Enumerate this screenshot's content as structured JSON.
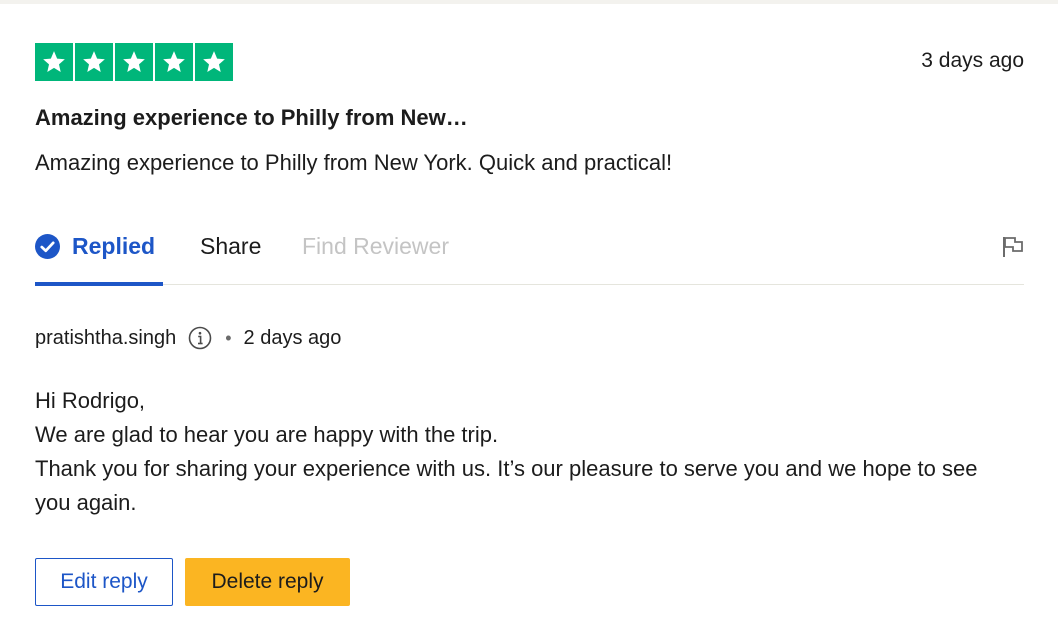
{
  "review": {
    "rating": 5,
    "rating_color": "#00b67a",
    "date": "3 days ago",
    "title": "Amazing experience to Philly from New…",
    "body": "Amazing experience to Philly from New York. Quick and practical!"
  },
  "tabs": {
    "replied": "Replied",
    "share": "Share",
    "find_reviewer": "Find Reviewer",
    "active_color": "#1d56c7",
    "disabled_color": "#c4c4c4"
  },
  "reply": {
    "author": "pratishtha.singh",
    "separator": "•",
    "date": "2 days ago",
    "lines": [
      "Hi Rodrigo,",
      "We are glad to hear you are happy with the trip.",
      "Thank you for sharing your experience with us. It’s our pleasure to serve you and we hope to see you again."
    ]
  },
  "actions": {
    "edit_label": "Edit reply",
    "delete_label": "Delete reply",
    "delete_color": "#fbb522"
  },
  "icons": {
    "star": "star-icon",
    "check": "check-circle-icon",
    "info": "info-icon",
    "flag": "flag-icon"
  }
}
